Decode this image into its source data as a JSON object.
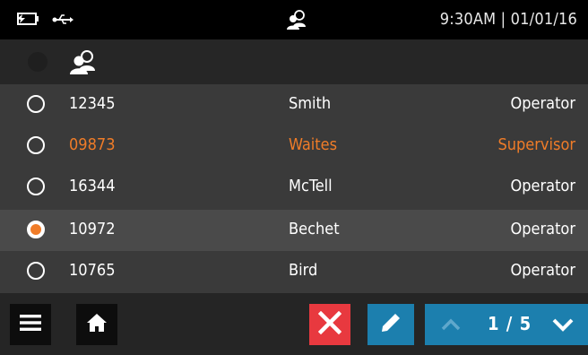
{
  "status_bar": {
    "datetime": "9:30AM | 01/01/16",
    "icons": [
      "battery-charging-icon",
      "usb-icon",
      "users-group-icon"
    ]
  },
  "header": {
    "icons": [
      "select-all-radio",
      "users-group-icon"
    ]
  },
  "users": [
    {
      "id": "12345",
      "name": "Smith",
      "role": "Operator",
      "selected": false,
      "accent": false
    },
    {
      "id": "09873",
      "name": "Waites",
      "role": "Supervisor",
      "selected": false,
      "accent": true
    },
    {
      "id": "16344",
      "name": "McTell",
      "role": "Operator",
      "selected": false,
      "accent": false
    },
    {
      "id": "10972",
      "name": "Bechet",
      "role": "Operator",
      "selected": true,
      "accent": false
    },
    {
      "id": "10765",
      "name": "Bird",
      "role": "Operator",
      "selected": false,
      "accent": false
    }
  ],
  "toolbar": {
    "page_info": "1 / 5",
    "icons": [
      "menu-icon",
      "home-icon",
      "close-icon",
      "edit-pencil-icon",
      "chevron-up-icon",
      "chevron-down-icon"
    ]
  },
  "colors": {
    "accent": "#f07c28",
    "delete": "#e8393f",
    "primary": "#1c7fae",
    "list_bg": "#3a3a3a",
    "selected_row_bg": "#4a4a4a"
  }
}
